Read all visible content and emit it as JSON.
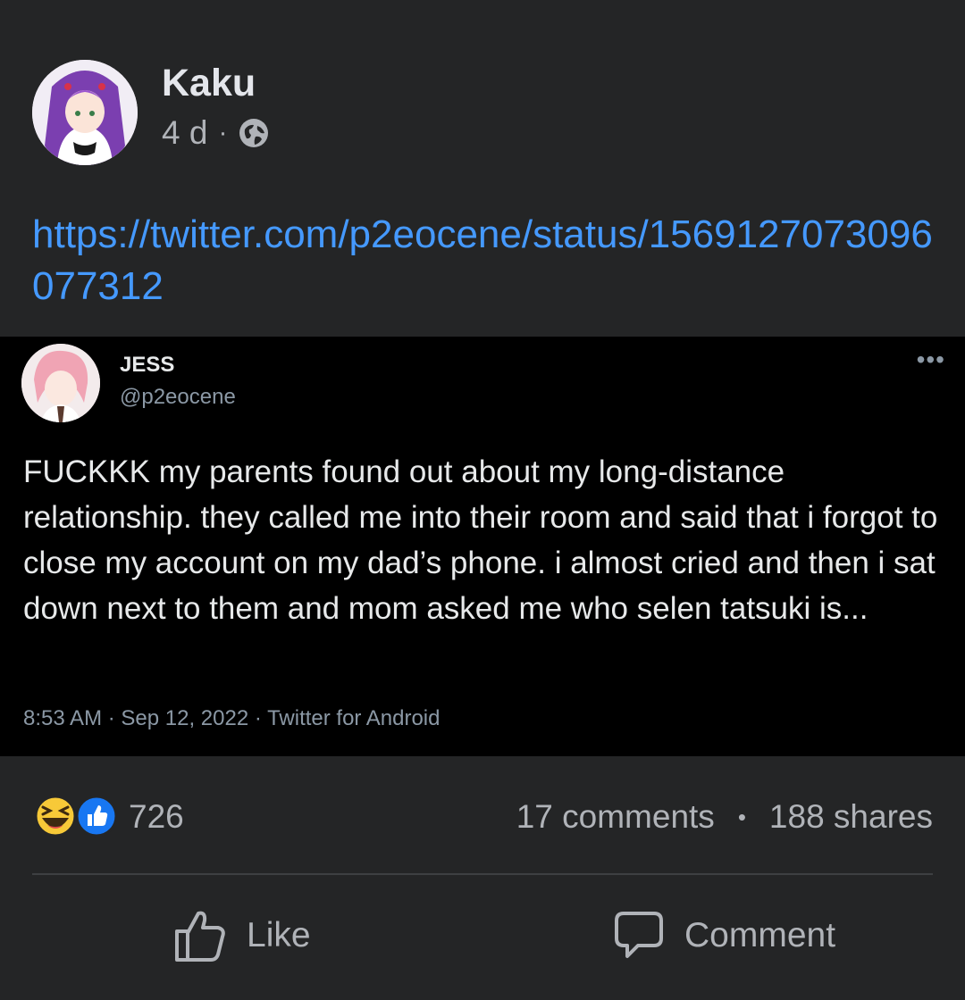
{
  "post": {
    "author": "Kaku",
    "age": "4 d",
    "separator": "·",
    "privacy_icon": "globe-icon",
    "link_text": "https://twitter.com/p2eocene/status/1569127073096077312"
  },
  "tweet": {
    "display_name": "JESS",
    "handle": "@p2eocene",
    "more_icon": "•••",
    "text": "FUCKKK my parents found out about my long-distance relationship. they called me into their room and said that i forgot to close my account on my dad’s phone. i almost cried and then i sat down next to them and mom asked me who selen tatsuki is...",
    "footer": "8:53 AM · Sep 12, 2022 · Twitter for Android"
  },
  "stats": {
    "reaction_icons": [
      "haha-icon",
      "like-icon"
    ],
    "reaction_count": "726",
    "comments": "17 comments",
    "dot": "•",
    "shares": "188 shares"
  },
  "actions": {
    "like_label": "Like",
    "comment_label": "Comment"
  },
  "colors": {
    "background": "#242526",
    "link": "#4599ff",
    "tweet_background": "#000000",
    "like_blue": "#1877f2",
    "haha_yellow": "#f7c938"
  }
}
